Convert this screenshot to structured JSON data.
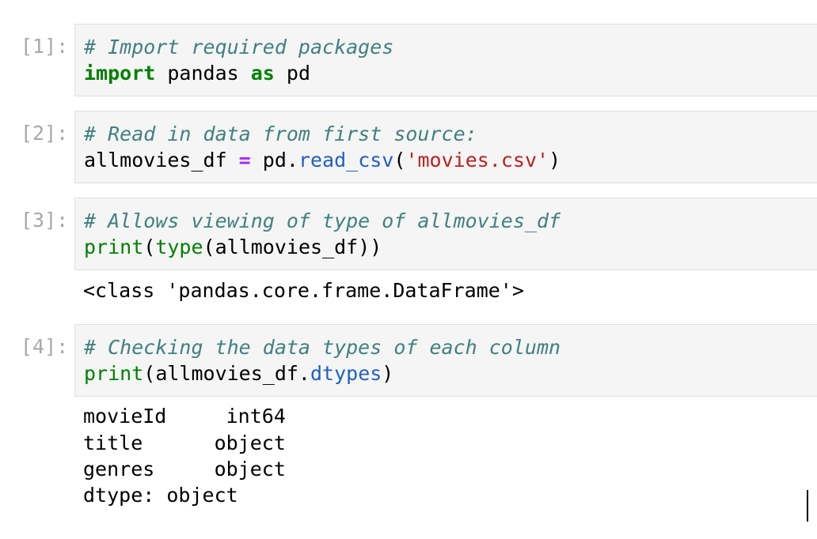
{
  "cells": [
    {
      "prompt": "[1]:",
      "comment": "# Import required packages",
      "kw_import": "import",
      "module": " pandas ",
      "kw_as": "as",
      "alias": " pd"
    },
    {
      "prompt": "[2]:",
      "comment": "# Read in data from first source:",
      "var": "allmovies_df ",
      "op_eq": "=",
      "obj": " pd.",
      "method": "read_csv",
      "paren_open": "(",
      "string": "'movies.csv'",
      "paren_close": ")"
    },
    {
      "prompt": "[3]:",
      "comment": "# Allows viewing of type of allmovies_df",
      "fn_print": "print",
      "paren_open": "(",
      "fn_type": "type",
      "arg": "(allmovies_df))",
      "output": "<class 'pandas.core.frame.DataFrame'>"
    },
    {
      "prompt": "[4]:",
      "comment": "# Checking the data types of each column",
      "fn_print": "print",
      "arg": "(allmovies_df.",
      "attr": "dtypes",
      "paren_close": ")",
      "output_lines": [
        "movieId     int64",
        "title      object",
        "genres     object",
        "dtype: object"
      ]
    }
  ]
}
